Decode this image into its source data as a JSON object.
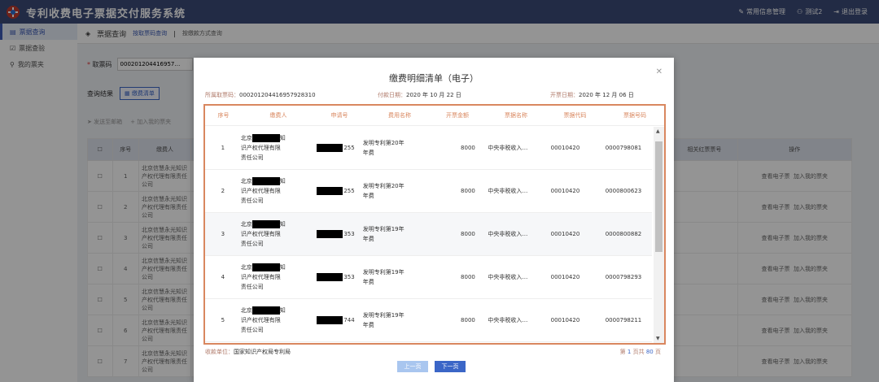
{
  "app": {
    "title": "专利收费电子票据交付服务系统",
    "common_info": "常用信息管理",
    "user": "测试2",
    "logout": "退出登录"
  },
  "sidebar": {
    "items": [
      {
        "label": "票据查询",
        "active": true
      },
      {
        "label": "票据查验",
        "active": false
      },
      {
        "label": "我的票夹",
        "active": false
      }
    ]
  },
  "main": {
    "breadcrumb_title": "票据查询",
    "tab_by_code": "按取票码查询",
    "tab_by_other": "按缴款方式查询",
    "code_label": "取票码",
    "code_value": "000201204416957…",
    "result_label": "查询结果",
    "result_button": "缴费清单",
    "action_email": "发送至邮箱",
    "action_folder": "加入我的票夹",
    "table_headers": [
      "",
      "序号",
      "缴费人",
      "",
      "相关红票票号",
      "操作"
    ],
    "rows": [
      {
        "no": "1",
        "payer": "北京信慧永光知识产权代理有限责任公司",
        "view": "查看电子票",
        "add": "加入我的票夹"
      },
      {
        "no": "2",
        "payer": "北京信慧永光知识产权代理有限责任公司",
        "view": "查看电子票",
        "add": "加入我的票夹"
      },
      {
        "no": "3",
        "payer": "北京信慧永光知识产权代理有限责任公司",
        "view": "查看电子票",
        "add": "加入我的票夹"
      },
      {
        "no": "4",
        "payer": "北京信慧永光知识产权代理有限责任公司",
        "view": "查看电子票",
        "add": "加入我的票夹"
      },
      {
        "no": "5",
        "payer": "北京信慧永光知识产权代理有限责任公司",
        "view": "查看电子票",
        "add": "加入我的票夹"
      },
      {
        "no": "6",
        "payer": "北京信慧永光知识产权代理有限责任公司",
        "view": "查看电子票",
        "add": "加入我的票夹"
      },
      {
        "no": "7",
        "payer": "北京信慧永光知识产权代理有限责任公司",
        "view": "查看电子票",
        "add": "加入我的票夹"
      }
    ]
  },
  "modal": {
    "title": "缴费明细清单（电子）",
    "code_label": "所属取票码：",
    "code_value": "000201204416957928310",
    "paid_label": "付款日期：",
    "paid_value": "2020 年 10 月 22 日",
    "issued_label": "开票日期：",
    "issued_value": "2020 年 12 月 06 日",
    "headers": [
      "序号",
      "缴费人",
      "申请号",
      "费用名称",
      "开票金额",
      "票据名称",
      "票据代码",
      "票据号码"
    ],
    "rows": [
      {
        "seq": "1",
        "payer_a": "北京",
        "payer_b": "知",
        "payer_c": "识产权代理有限",
        "payer_d": "责任公司",
        "app_tail": "255",
        "fee_a": "发明专利第20年",
        "fee_b": "年费",
        "amount": "8000",
        "name": "中央非税收入…",
        "code": "00010420",
        "number": "0000798081"
      },
      {
        "seq": "2",
        "payer_a": "北京",
        "payer_b": "知",
        "payer_c": "识产权代理有限",
        "payer_d": "责任公司",
        "app_tail": "255",
        "fee_a": "发明专利第20年",
        "fee_b": "年费",
        "amount": "8000",
        "name": "中央非税收入…",
        "code": "00010420",
        "number": "0000800623"
      },
      {
        "seq": "3",
        "payer_a": "北京",
        "payer_b": "知",
        "payer_c": "识产权代理有限",
        "payer_d": "责任公司",
        "app_tail": "353",
        "fee_a": "发明专利第19年",
        "fee_b": "年费",
        "amount": "8000",
        "name": "中央非税收入…",
        "code": "00010420",
        "number": "0000800882"
      },
      {
        "seq": "4",
        "payer_a": "北京",
        "payer_b": "知",
        "payer_c": "识产权代理有限",
        "payer_d": "责任公司",
        "app_tail": "353",
        "fee_a": "发明专利第19年",
        "fee_b": "年费",
        "amount": "8000",
        "name": "中央非税收入…",
        "code": "00010420",
        "number": "0000798293"
      },
      {
        "seq": "5",
        "payer_a": "北京",
        "payer_b": "知",
        "payer_c": "识产权代理有限",
        "payer_d": "责任公司",
        "app_tail": "744",
        "fee_a": "发明专利第19年",
        "fee_b": "年费",
        "amount": "8000",
        "name": "中央非税收入…",
        "code": "00010420",
        "number": "0000798211"
      }
    ],
    "collector_label": "收款单位：",
    "collector_value": "国家知识产权局专利局",
    "page_prefix": "第",
    "page_current": "1",
    "page_mid": "页共",
    "page_total": "80",
    "page_suffix": "页",
    "prev_button": "上一页",
    "next_button": "下一页"
  },
  "colors": {
    "topbar": "#3b4a77",
    "accent": "#3b66c7",
    "frame": "#d9875f"
  }
}
